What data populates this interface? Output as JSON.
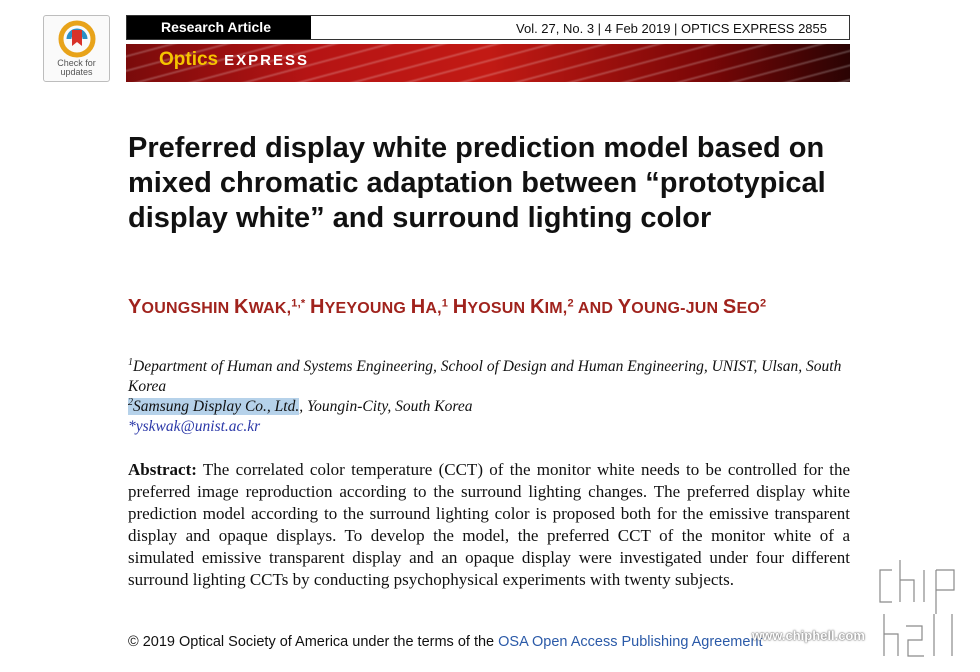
{
  "badge": {
    "line1": "Check for",
    "line2": "updates"
  },
  "header": {
    "article_type": "Research Article",
    "citation": "Vol. 27, No. 3 | 4 Feb 2019 | OPTICS EXPRESS 2855",
    "journal_a": "Optics",
    "journal_b": "EXPRESS"
  },
  "title": "Preferred display white prediction model based on mixed chromatic adaptation between “prototypical display white” and surround lighting color",
  "authors": [
    {
      "first": "Y",
      "rest": "OUNGSHIN ",
      "last_first": "K",
      "last_rest": "WAK,",
      "sup": "1,*"
    },
    {
      "first": "H",
      "rest": "YEYOUNG ",
      "last_first": "H",
      "last_rest": "A,",
      "sup": "1"
    },
    {
      "first": "H",
      "rest": "YOSUN ",
      "last_first": "K",
      "last_rest": "IM,",
      "sup": "2"
    },
    {
      "and": "AND ",
      "first": "Y",
      "rest": "OUNG-JUN ",
      "last_first": "S",
      "last_rest": "EO",
      "sup": "2"
    }
  ],
  "affiliations": {
    "a1_sup": "1",
    "a1_text": "Department of Human and Systems Engineering, School of Design and Human Engineering, UNIST, Ulsan, South Korea",
    "a2_sup": "2",
    "a2_org": "Samsung Display Co., Ltd.",
    "a2_rest": ", Youngin-City, South Korea",
    "email": "*yskwak@unist.ac.kr"
  },
  "abstract": {
    "label": "Abstract:",
    "text": " The correlated color temperature (CCT) of the monitor white needs to be controlled for the preferred image reproduction according to the surround lighting changes. The preferred display white prediction model according to the surround lighting color is proposed both for the emissive transparent display and opaque displays. To develop the model, the preferred CCT of the monitor white of a simulated emissive transparent display and an opaque display were investigated under four different surround lighting CCTs by conducting psychophysical experiments with twenty subjects."
  },
  "copyright": {
    "text": "© 2019 Optical Society of America under the terms of the ",
    "link": "OSA Open Access Publishing Agreement"
  },
  "watermark": {
    "url": "www.chiphell.com"
  },
  "colors": {
    "author": "#a0231d",
    "link": "#2b5aa8",
    "highlight": "#b6d2ea",
    "banner": "#b51414"
  }
}
